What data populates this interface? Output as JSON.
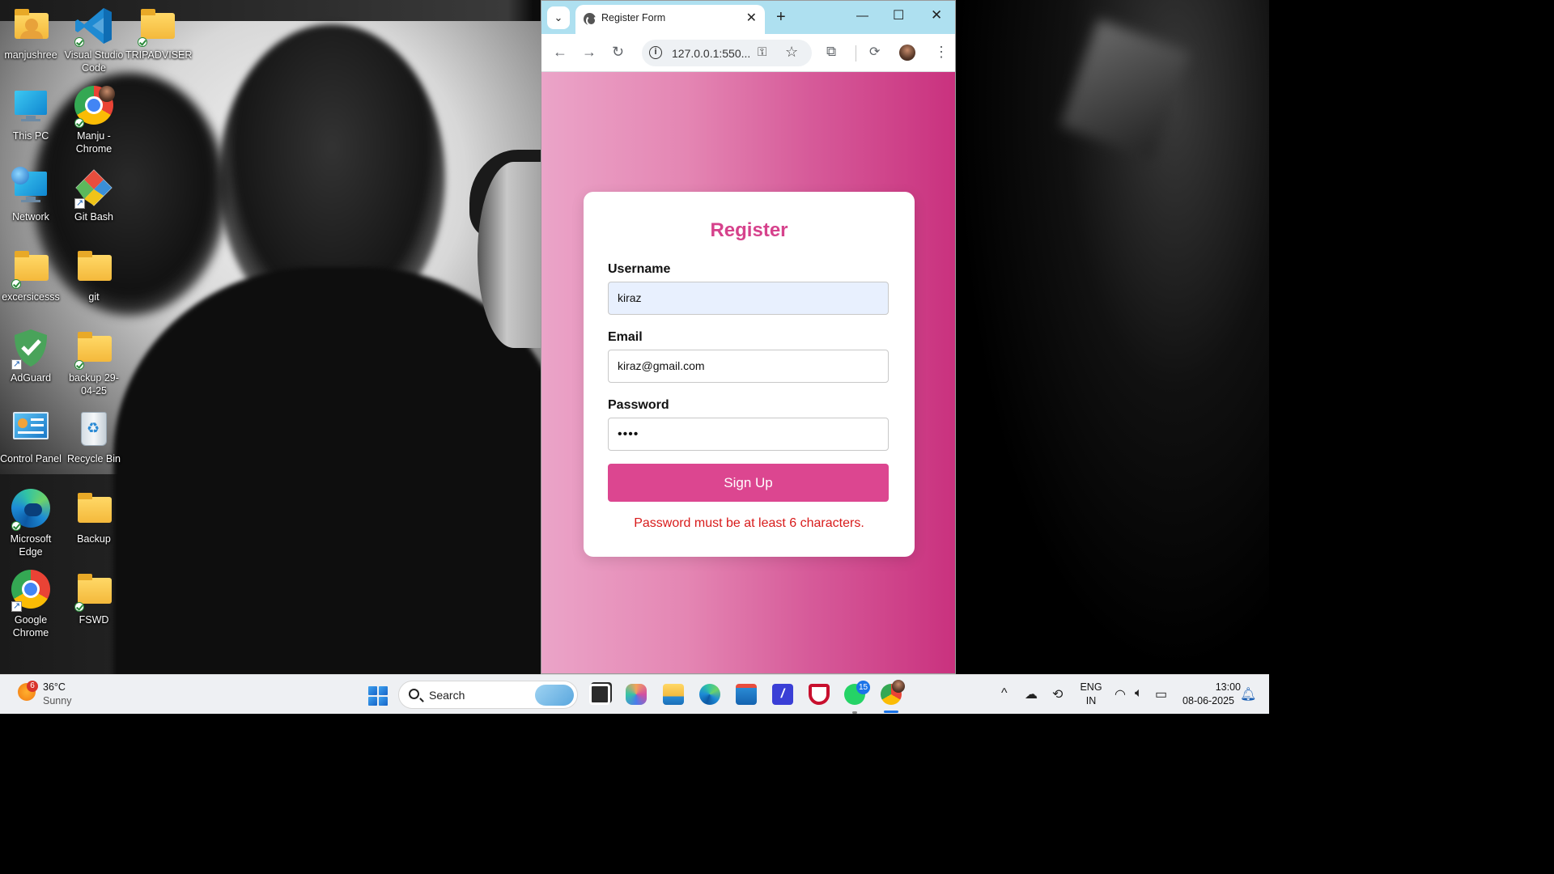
{
  "desktop": {
    "icons": [
      {
        "label": "manjushree",
        "icon": "user-folder-icon"
      },
      {
        "label": "Visual Studio Code",
        "icon": "vscode-icon"
      },
      {
        "label": "TRIPADVISER",
        "icon": "folder-icon"
      },
      {
        "label": "This PC",
        "icon": "monitor-icon"
      },
      {
        "label": "Manju - Chrome",
        "icon": "chrome-profile-icon"
      },
      {
        "label": "Network",
        "icon": "network-icon"
      },
      {
        "label": "Git Bash",
        "icon": "git-bash-icon"
      },
      {
        "label": "excersicesss",
        "icon": "folder-icon"
      },
      {
        "label": "git",
        "icon": "folder-icon"
      },
      {
        "label": "AdGuard",
        "icon": "adguard-icon"
      },
      {
        "label": "backup 29-04-25",
        "icon": "folder-icon"
      },
      {
        "label": "Control Panel",
        "icon": "control-panel-icon"
      },
      {
        "label": "Recycle Bin",
        "icon": "recycle-bin-icon"
      },
      {
        "label": "Microsoft Edge",
        "icon": "edge-icon"
      },
      {
        "label": "Backup",
        "icon": "folder-icon"
      },
      {
        "label": "Google Chrome",
        "icon": "chrome-icon"
      },
      {
        "label": "FSWD",
        "icon": "folder-icon"
      }
    ]
  },
  "browser": {
    "tab_title": "Register Form",
    "url": "127.0.0.1:550...",
    "accent": "#aee0f0"
  },
  "form": {
    "title": "Register",
    "username_label": "Username",
    "username_value": "kiraz",
    "email_label": "Email",
    "email_value": "kiraz@gmail.com",
    "password_label": "Password",
    "password_value": "••••",
    "submit_label": "Sign Up",
    "error_message": "Password must be at least 6 characters.",
    "colors": {
      "primary": "#dc4690",
      "title": "#d6428c",
      "error": "#d81b1b"
    }
  },
  "taskbar": {
    "weather_badge": "6",
    "weather_temp": "36°C",
    "weather_desc": "Sunny",
    "search_label": "Search",
    "whatsapp_badge": "15",
    "lang_top": "ENG",
    "lang_bottom": "IN",
    "time": "13:00",
    "date": "08-06-2025"
  }
}
